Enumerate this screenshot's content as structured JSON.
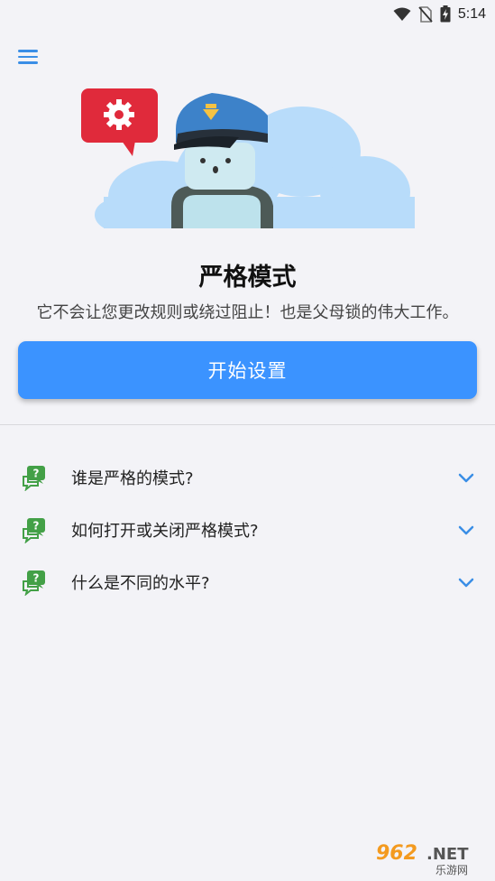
{
  "status_bar": {
    "time": "5:14",
    "icons": [
      "wifi-icon",
      "no-sim-icon",
      "battery-charging-icon"
    ]
  },
  "toolbar": {
    "menu_icon": "hamburger-menu-icon"
  },
  "hero": {
    "illustration": "police-robot-with-gear-speech-bubble"
  },
  "main": {
    "title": "严格模式",
    "subtitle": "它不会让您更改规则或绕过阻止！也是父母锁的伟大工作。",
    "start_button_label": "开始设置"
  },
  "faq": {
    "items": [
      {
        "question": "谁是严格的模式?",
        "icon": "question-chat-icon"
      },
      {
        "question": "如何打开或关闭严格模式?",
        "icon": "question-chat-icon"
      },
      {
        "question": "什么是不同的水平?",
        "icon": "question-chat-icon"
      }
    ]
  },
  "watermark": {
    "brand": "962.NET",
    "sub": "乐游网"
  },
  "colors": {
    "accent": "#3b93ff",
    "menu": "#3a8ee6",
    "faq_icon": "#43a047",
    "bubble_red": "#e02a3b",
    "background": "#f3f3f7"
  }
}
